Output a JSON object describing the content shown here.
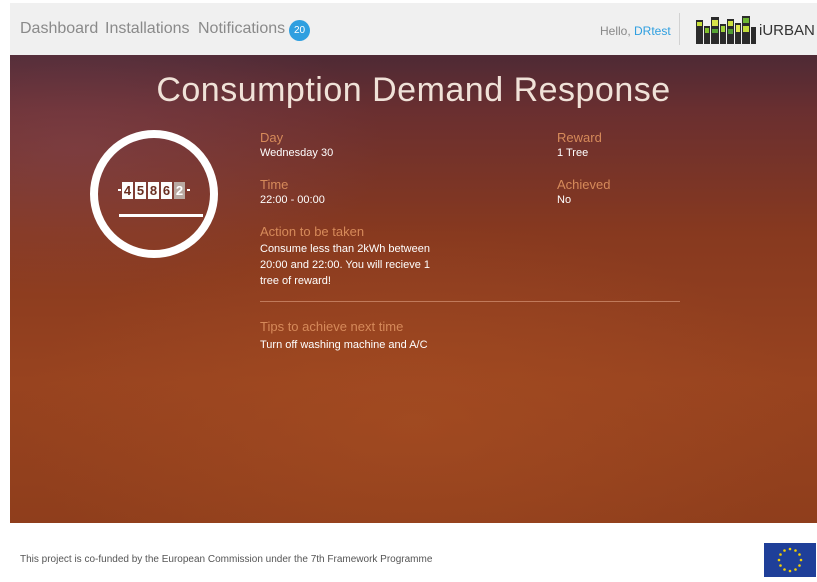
{
  "nav": {
    "dashboard": "Dashboard",
    "installations": "Installations",
    "notifications": "Notifications",
    "notifications_count": "20",
    "greeting": "Hello, ",
    "username": "DRtest",
    "brand": "iURBAN"
  },
  "page": {
    "title": "Consumption Demand Response"
  },
  "meter": {
    "digits": [
      "4",
      "5",
      "8",
      "6",
      "2"
    ]
  },
  "fields": {
    "day_label": "Day",
    "day_value": "Wednesday 30",
    "time_label": "Time",
    "time_value": "22:00 - 00:00",
    "action_label": "Action to be taken",
    "action_value": "Consume less than 2kWh between 20:00 and 22:00. You will recieve 1 tree of reward!",
    "reward_label": "Reward",
    "reward_value": "1 Tree",
    "achieved_label": "Achieved",
    "achieved_value": "No",
    "tips_label": "Tips to achieve next time",
    "tips_value": "Turn off washing machine and A/C"
  },
  "footer": {
    "text": "This project is co-funded by the European Commission under the 7th Framework Programme"
  }
}
